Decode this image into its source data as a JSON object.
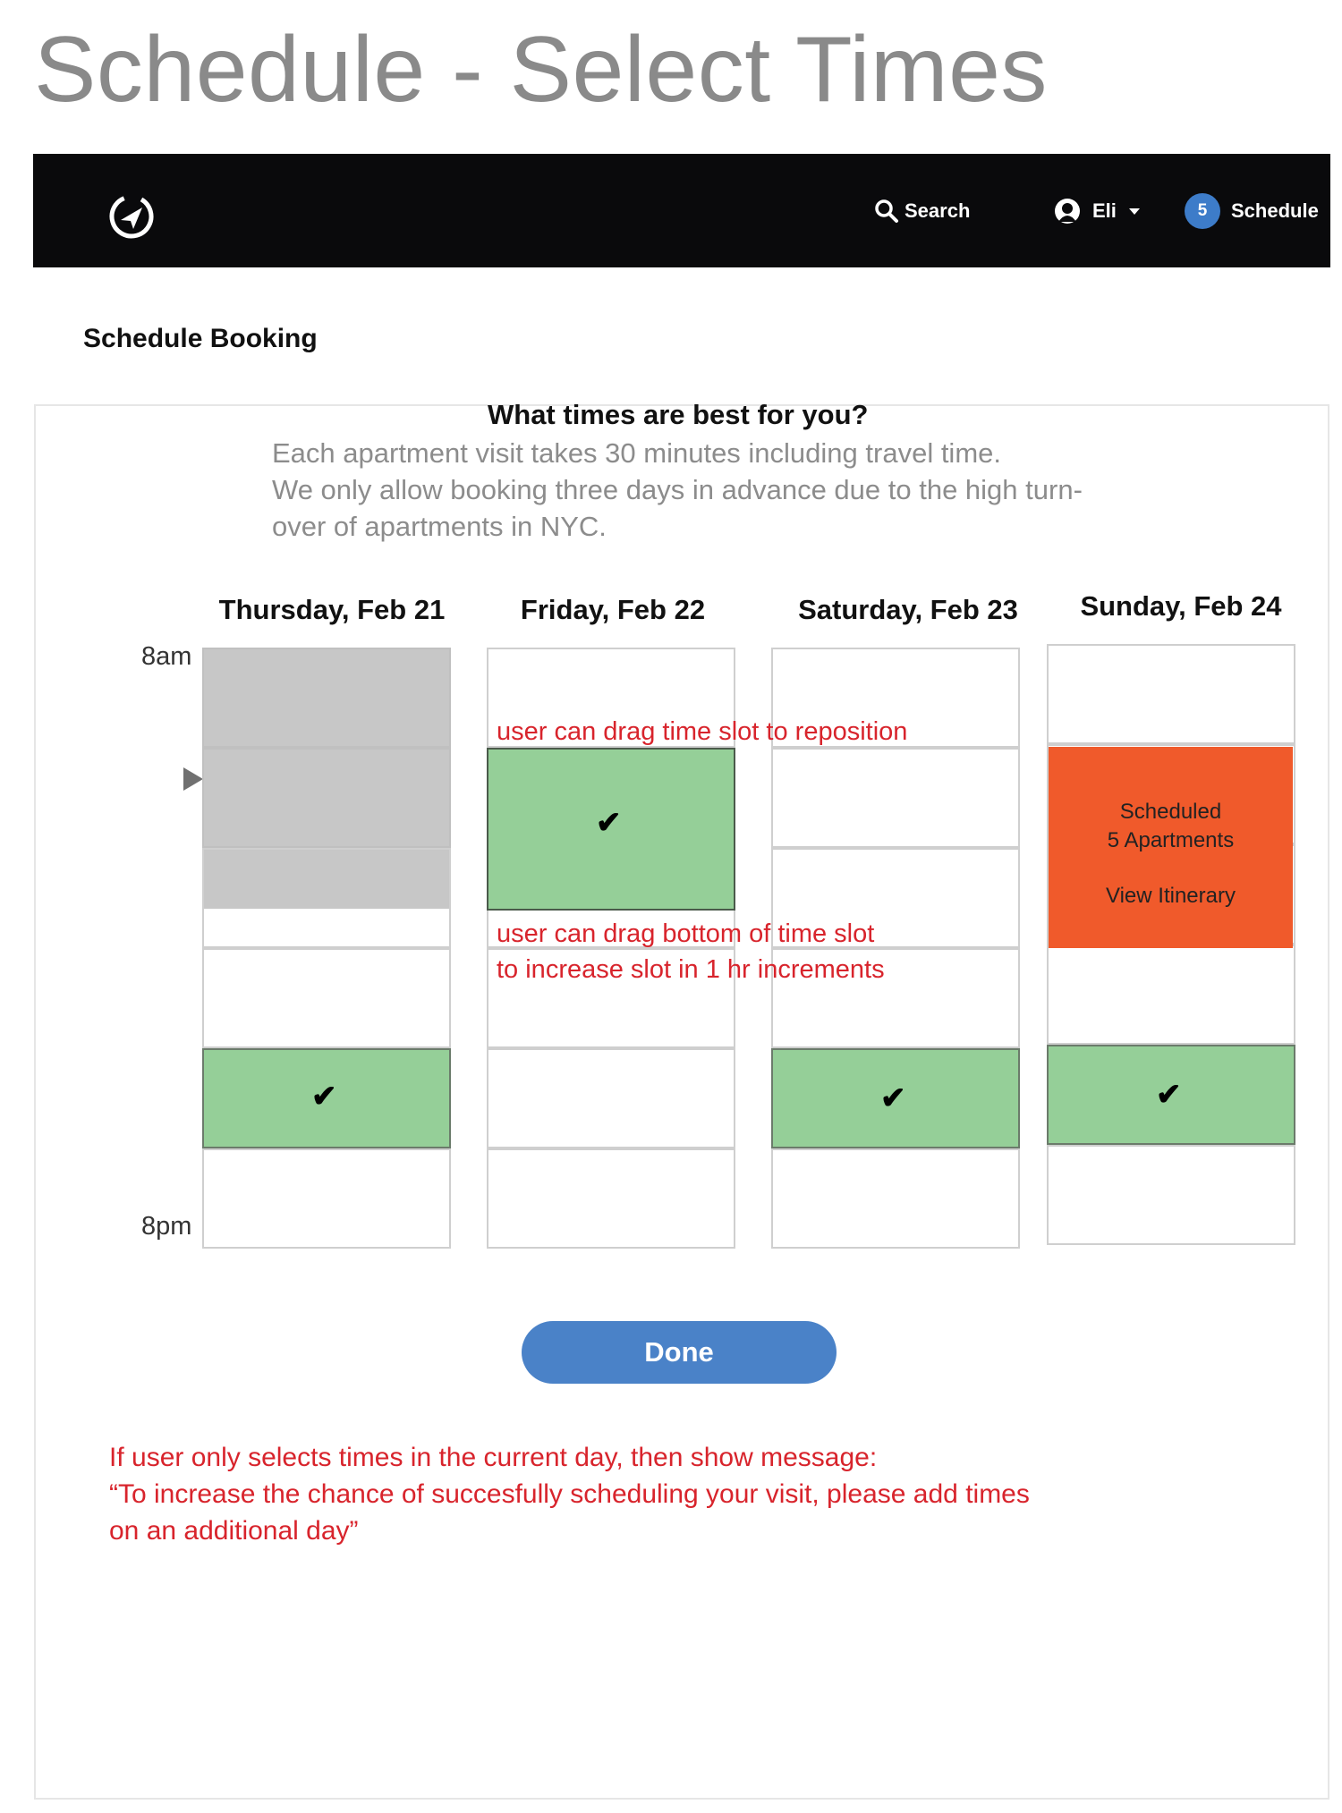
{
  "page_title": "Schedule - Select Times",
  "navbar": {
    "search_label": "Search",
    "user_name": "Eli",
    "schedule_count": "5",
    "schedule_label": "Schedule"
  },
  "section_heading": "Schedule Booking",
  "prompt": {
    "question": "What times are best for you?",
    "info_lines": [
      "Each apartment visit takes 30 minutes including travel time.",
      "We only allow booking three days in advance due to the high turn-",
      "over of apartments in NYC."
    ]
  },
  "time_labels": {
    "start": "8am",
    "end": "8pm"
  },
  "days": [
    {
      "label": "Thursday, Feb 21"
    },
    {
      "label": "Friday, Feb 22"
    },
    {
      "label": "Saturday, Feb 23"
    },
    {
      "label": "Sunday, Feb 24"
    }
  ],
  "check_glyph": "✔",
  "scheduled_block": {
    "line1": "Scheduled",
    "line2": "5 Apartments",
    "link": "View Itinerary",
    "color": "#f05a2b"
  },
  "annotations": {
    "drag_reposition": "user can drag time slot to reposition",
    "drag_bottom_line1": "user can drag bottom of time slot",
    "drag_bottom_line2": "to increase slot in 1 hr increments"
  },
  "done_label": "Done",
  "bottom_note": {
    "line1": "If user only selects times in the current day, then show message:",
    "line2": "“To increase the chance of succesfully scheduling your visit, please add times",
    "line3": "on an additional day”"
  },
  "colors": {
    "navbar": "#0a0a0c",
    "badge": "#3d7cc9",
    "selected_slot": "#95cf98",
    "unavailable_slot": "#c7c7c7",
    "annotation": "#d8242c",
    "done_button": "#4a82c8"
  }
}
